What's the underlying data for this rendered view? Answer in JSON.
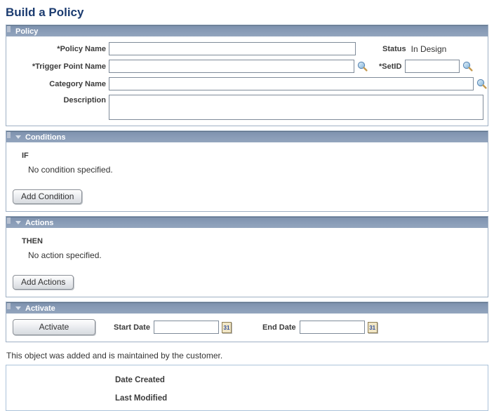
{
  "page": {
    "title": "Build a Policy"
  },
  "policy": {
    "header": "Policy",
    "policy_name_label": "*Policy Name",
    "policy_name_value": "",
    "status_label": "Status",
    "status_value": "In Design",
    "trigger_point_label": "*Trigger Point Name",
    "trigger_point_value": "",
    "setid_label": "*SetID",
    "setid_value": "",
    "category_label": "Category Name",
    "category_value": "",
    "description_label": "Description",
    "description_value": ""
  },
  "conditions": {
    "header": "Conditions",
    "keyword": "IF",
    "empty_text": "No condition specified.",
    "add_button_label": "Add Condition"
  },
  "actions": {
    "header": "Actions",
    "keyword": "THEN",
    "empty_text": "No action specified.",
    "add_button_label": "Add Actions"
  },
  "activate": {
    "header": "Activate",
    "button_label": "Activate",
    "start_date_label": "Start Date",
    "start_date_value": "",
    "end_date_label": "End Date",
    "end_date_value": "",
    "calendar_icon_text": "31"
  },
  "footer": {
    "note": "This object was added and is maintained by the customer.",
    "date_created_label": "Date Created",
    "last_modified_label": "Last Modified"
  },
  "colors": {
    "title": "#1c3c70",
    "header_bar": "#8a9db8",
    "header_text": "#ffffff",
    "box_border": "#9fb0c4",
    "meta_box_border": "#abc3da"
  }
}
